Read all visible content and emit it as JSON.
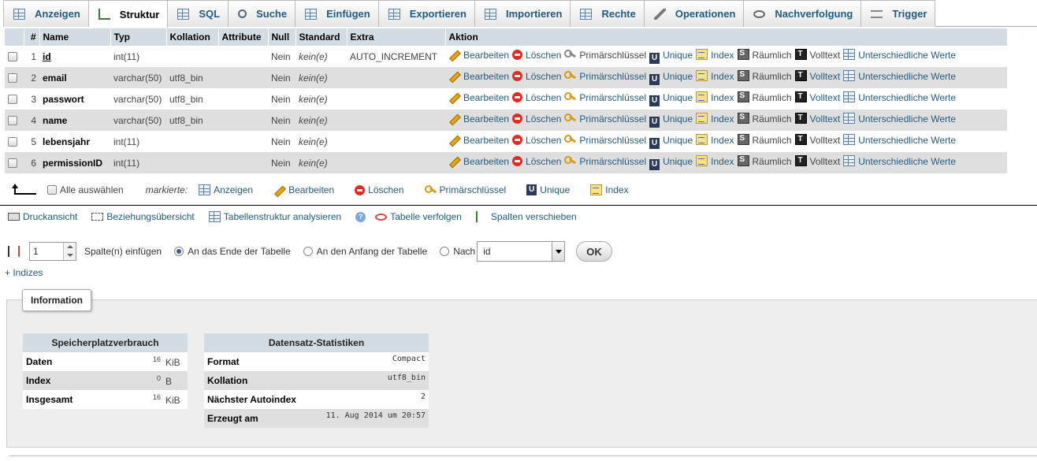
{
  "tabs": [
    {
      "label": "Anzeigen",
      "icon": "browse-icon",
      "active": false
    },
    {
      "label": "Struktur",
      "icon": "structure-icon",
      "active": true
    },
    {
      "label": "SQL",
      "icon": "sql-icon",
      "active": false
    },
    {
      "label": "Suche",
      "icon": "search-icon",
      "active": false
    },
    {
      "label": "Einfügen",
      "icon": "insert-icon",
      "active": false
    },
    {
      "label": "Exportieren",
      "icon": "export-icon",
      "active": false
    },
    {
      "label": "Importieren",
      "icon": "import-icon",
      "active": false
    },
    {
      "label": "Rechte",
      "icon": "privileges-icon",
      "active": false
    },
    {
      "label": "Operationen",
      "icon": "wrench-icon",
      "active": false
    },
    {
      "label": "Nachverfolgung",
      "icon": "eye-icon",
      "active": false
    },
    {
      "label": "Trigger",
      "icon": "trigger-icon",
      "active": false
    }
  ],
  "table": {
    "headers": [
      "#",
      "Name",
      "Typ",
      "Kollation",
      "Attribute",
      "Null",
      "Standard",
      "Extra",
      "Aktion"
    ],
    "rows": [
      {
        "num": "1",
        "name": "id",
        "type": "int(11)",
        "collation": "",
        "attributes": "",
        "null": "Nein",
        "default": "kein(e)",
        "extra": "AUTO_INCREMENT",
        "primary": true
      },
      {
        "num": "2",
        "name": "email",
        "type": "varchar(50)",
        "collation": "utf8_bin",
        "attributes": "",
        "null": "Nein",
        "default": "kein(e)",
        "extra": "",
        "primary": false
      },
      {
        "num": "3",
        "name": "passwort",
        "type": "varchar(50)",
        "collation": "utf8_bin",
        "attributes": "",
        "null": "Nein",
        "default": "kein(e)",
        "extra": "",
        "primary": false
      },
      {
        "num": "4",
        "name": "name",
        "type": "varchar(50)",
        "collation": "utf8_bin",
        "attributes": "",
        "null": "Nein",
        "default": "kein(e)",
        "extra": "",
        "primary": false
      },
      {
        "num": "5",
        "name": "lebensjahr",
        "type": "int(11)",
        "collation": "",
        "attributes": "",
        "null": "Nein",
        "default": "kein(e)",
        "extra": "",
        "primary": false
      },
      {
        "num": "6",
        "name": "permissionID",
        "type": "int(11)",
        "collation": "",
        "attributes": "",
        "null": "Nein",
        "default": "kein(e)",
        "extra": "",
        "primary": false
      }
    ],
    "actions": {
      "edit": "Bearbeiten",
      "delete": "Löschen",
      "primary": "Primärschlüssel",
      "unique": "Unique",
      "index": "Index",
      "spatial": "Räumlich",
      "fulltext": "Volltext",
      "distinct": "Unterschiedliche Werte"
    }
  },
  "bulk": {
    "select_all": "Alle auswählen",
    "marked": "markierte:",
    "browse": "Anzeigen",
    "edit": "Bearbeiten",
    "delete": "Löschen",
    "primary": "Primärschlüssel",
    "unique": "Unique",
    "index": "Index"
  },
  "links": {
    "print": "Druckansicht",
    "relation": "Beziehungsübersicht",
    "analyze": "Tabellenstruktur analysieren",
    "help": "?",
    "track": "Tabelle verfolgen",
    "move": "Spalten verschieben"
  },
  "add_columns": {
    "count": "1",
    "label": "Spalte(n) einfügen",
    "opt_end": "An das Ende der Tabelle",
    "opt_begin": "An den Anfang der Tabelle",
    "opt_after": "Nach",
    "after_field": "id",
    "ok": "OK"
  },
  "indexes_toggle": "+ Indizes",
  "information": {
    "legend": "Information",
    "space": {
      "title": "Speicherplatzverbrauch",
      "rows": [
        {
          "label": "Daten",
          "value": "16",
          "unit": "KiB"
        },
        {
          "label": "Index",
          "value": "0",
          "unit": "B"
        },
        {
          "label": "Insgesamt",
          "value": "16",
          "unit": "KiB"
        }
      ]
    },
    "stats": {
      "title": "Datensatz-Statistiken",
      "rows": [
        {
          "label": "Format",
          "value": "Compact"
        },
        {
          "label": "Kollation",
          "value": "utf8_bin"
        },
        {
          "label": "Nächster Autoindex",
          "value": "2"
        },
        {
          "label": "Erzeugt am",
          "value": "11. Aug 2014 um 20:57"
        }
      ]
    }
  }
}
